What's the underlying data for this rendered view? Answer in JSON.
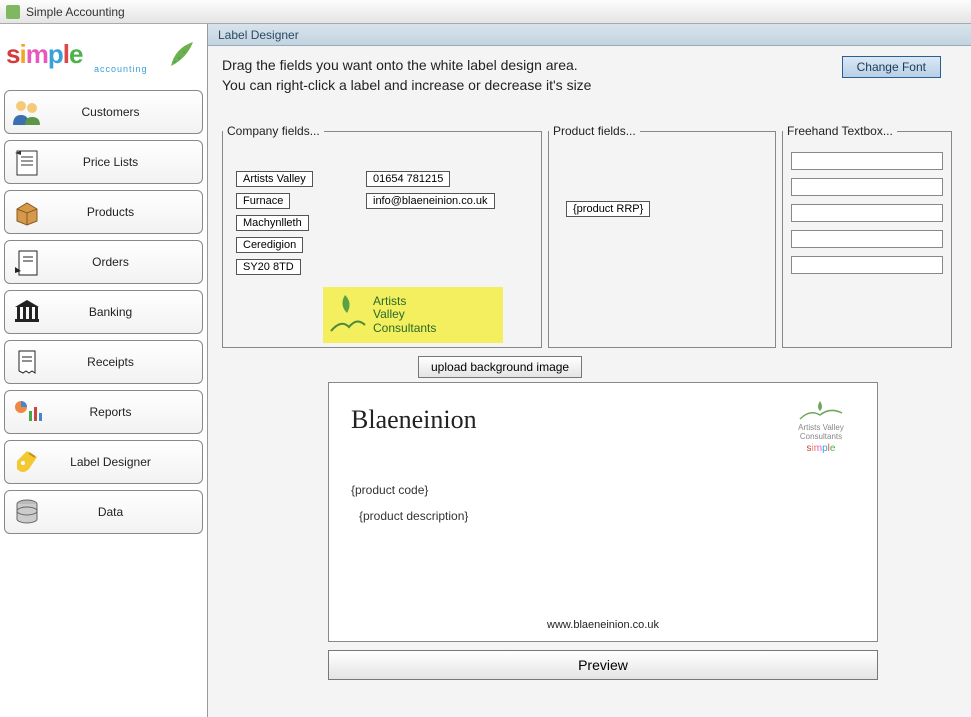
{
  "window": {
    "title": "Simple Accounting"
  },
  "logo": {
    "letters": [
      "s",
      "i",
      "m",
      "p",
      "l",
      "e"
    ],
    "sub": "accounting"
  },
  "nav": [
    {
      "id": "customers",
      "label": "Customers"
    },
    {
      "id": "pricelists",
      "label": "Price Lists"
    },
    {
      "id": "products",
      "label": "Products"
    },
    {
      "id": "orders",
      "label": "Orders"
    },
    {
      "id": "banking",
      "label": "Banking"
    },
    {
      "id": "receipts",
      "label": "Receipts"
    },
    {
      "id": "reports",
      "label": "Reports"
    },
    {
      "id": "labeldesigner",
      "label": "Label Designer"
    },
    {
      "id": "data",
      "label": "Data"
    }
  ],
  "panel": {
    "title": "Label Designer",
    "instructions_l1": "Drag the fields you want onto the white label design area.",
    "instructions_l2": "You can right-click a label and increase or decrease it's size",
    "change_font": "Change Font",
    "upload_bg": "upload background image",
    "preview": "Preview"
  },
  "fieldsets": {
    "company": {
      "legend": "Company fields...",
      "col1": [
        "Artists Valley",
        "Furnace",
        "Machynlleth",
        "Ceredigion",
        "SY20 8TD"
      ],
      "col2": [
        "01654 781215",
        "info@blaeneinion.co.uk"
      ],
      "logo_lines": [
        "Artists",
        "Valley",
        "Consultants"
      ]
    },
    "product": {
      "legend": "Product fields...",
      "chips": [
        "{product RRP}"
      ]
    },
    "freehand": {
      "legend": "Freehand Textbox...",
      "count": 5
    }
  },
  "canvas": {
    "title": "Blaeneinion",
    "logo_top": "Artists Valley Consultants",
    "product_code": "{product code}",
    "product_desc": "{product description}",
    "url": "www.blaeneinion.co.uk"
  }
}
